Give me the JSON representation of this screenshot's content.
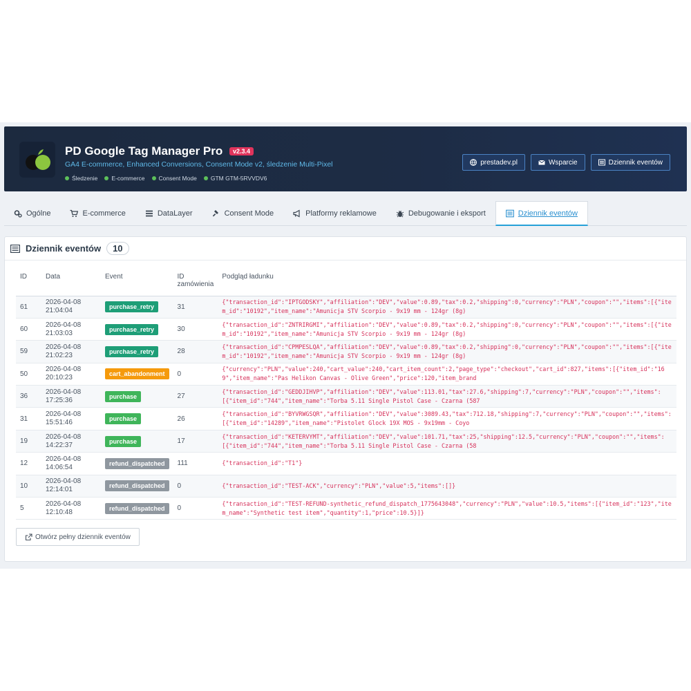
{
  "header": {
    "title": "PD Google Tag Manager Pro",
    "version": "v2.3.4",
    "subtitle": "GA4 E-commerce, Enhanced Conversions, Consent Mode v2, śledzenie Multi-Pixel",
    "features": [
      "Śledzenie",
      "E-commerce",
      "Consent Mode",
      "GTM GTM-5RVVDV6"
    ],
    "buttons": [
      {
        "label": "prestadev.pl",
        "icon": "globe-icon"
      },
      {
        "label": "Wsparcie",
        "icon": "envelope-icon"
      },
      {
        "label": "Dziennik eventów",
        "icon": "list-icon"
      }
    ]
  },
  "tabs": [
    {
      "label": "Ogólne",
      "icon": "cogs-icon"
    },
    {
      "label": "E-commerce",
      "icon": "cart-icon"
    },
    {
      "label": "DataLayer",
      "icon": "list-icon"
    },
    {
      "label": "Consent Mode",
      "icon": "gavel-icon"
    },
    {
      "label": "Platformy reklamowe",
      "icon": "bullhorn-icon"
    },
    {
      "label": "Debugowanie i eksport",
      "icon": "bug-icon"
    },
    {
      "label": "Dziennik eventów",
      "icon": "list-icon",
      "active": true
    }
  ],
  "panel": {
    "title": "Dziennik eventów",
    "count": "10",
    "columns": [
      "ID",
      "Data",
      "Event",
      "ID zamówienia",
      "Podgląd ładunku"
    ],
    "open_button": "Otwórz pełny dziennik eventów"
  },
  "colors": {
    "purchase_retry": "#1e9e77",
    "purchase": "#3fb55a",
    "cart_abandonment": "#f59a0c",
    "refund_dispatched": "#8f979f",
    "payload": "#d6305a",
    "accent": "#25a0d8"
  },
  "rows": [
    {
      "id": "61",
      "date": "2026-04-08",
      "time": "21:04:04",
      "event": "purchase_retry",
      "order": "31",
      "payload": "{\"transaction_id\":\"IPTGODSKY\",\"affiliation\":\"DEV\",\"value\":0.89,\"tax\":0.2,\"shipping\":0,\"currency\":\"PLN\",\"coupon\":\"\",\"items\":[{\"item_id\":\"10192\",\"item_name\":\"Amunicja STV Scorpio - 9x19 mm - 124gr (8g)"
    },
    {
      "id": "60",
      "date": "2026-04-08",
      "time": "21:03:03",
      "event": "purchase_retry",
      "order": "30",
      "payload": "{\"transaction_id\":\"ZNTRIRGMI\",\"affiliation\":\"DEV\",\"value\":0.89,\"tax\":0.2,\"shipping\":0,\"currency\":\"PLN\",\"coupon\":\"\",\"items\":[{\"item_id\":\"10192\",\"item_name\":\"Amunicja STV Scorpio - 9x19 mm - 124gr (8g)"
    },
    {
      "id": "59",
      "date": "2026-04-08",
      "time": "21:02:23",
      "event": "purchase_retry",
      "order": "28",
      "payload": "{\"transaction_id\":\"CPMPESLQA\",\"affiliation\":\"DEV\",\"value\":0.89,\"tax\":0.2,\"shipping\":0,\"currency\":\"PLN\",\"coupon\":\"\",\"items\":[{\"item_id\":\"10192\",\"item_name\":\"Amunicja STV Scorpio - 9x19 mm - 124gr (8g)"
    },
    {
      "id": "50",
      "date": "2026-04-08",
      "time": "20:10:23",
      "event": "cart_abandonment",
      "order": "0",
      "payload": "{\"currency\":\"PLN\",\"value\":240,\"cart_value\":240,\"cart_item_count\":2,\"page_type\":\"checkout\",\"cart_id\":827,\"items\":[{\"item_id\":\"169\",\"item_name\":\"Pas Helikon Canvas - Olive Green\",\"price\":120,\"item_brand"
    },
    {
      "id": "36",
      "date": "2026-04-08",
      "time": "17:25:36",
      "event": "purchase",
      "order": "27",
      "payload": "{\"transaction_id\":\"GEDDJIHVP\",\"affiliation\":\"DEV\",\"value\":113.01,\"tax\":27.6,\"shipping\":7,\"currency\":\"PLN\",\"coupon\":\"\",\"items\":[{\"item_id\":\"744\",\"item_name\":\"Torba 5.11 Single Pistol Case - Czarna (587"
    },
    {
      "id": "31",
      "date": "2026-04-08",
      "time": "15:51:46",
      "event": "purchase",
      "order": "26",
      "payload": "{\"transaction_id\":\"BYVRWGSQR\",\"affiliation\":\"DEV\",\"value\":3089.43,\"tax\":712.18,\"shipping\":7,\"currency\":\"PLN\",\"coupon\":\"\",\"items\":[{\"item_id\":\"14289\",\"item_name\":\"Pistolet Glock 19X MOS - 9x19mm - Coyo"
    },
    {
      "id": "19",
      "date": "2026-04-08",
      "time": "14:22:37",
      "event": "purchase",
      "order": "17",
      "payload": "{\"transaction_id\":\"KETERVYMT\",\"affiliation\":\"DEV\",\"value\":101.71,\"tax\":25,\"shipping\":12.5,\"currency\":\"PLN\",\"coupon\":\"\",\"items\":[{\"item_id\":\"744\",\"item_name\":\"Torba 5.11 Single Pistol Case - Czarna (58"
    },
    {
      "id": "12",
      "date": "2026-04-08",
      "time": "14:06:54",
      "event": "refund_dispatched",
      "order": "111",
      "payload": "{\"transaction_id\":\"T1\"}"
    },
    {
      "id": "10",
      "date": "2026-04-08",
      "time": "12:14:01",
      "event": "refund_dispatched",
      "order": "0",
      "payload": "{\"transaction_id\":\"TEST-ACK\",\"currency\":\"PLN\",\"value\":5,\"items\":[]}"
    },
    {
      "id": "5",
      "date": "2026-04-08",
      "time": "12:10:48",
      "event": "refund_dispatched",
      "order": "0",
      "payload": "{\"transaction_id\":\"TEST-REFUND-synthetic_refund_dispatch_1775643048\",\"currency\":\"PLN\",\"value\":10.5,\"items\":[{\"item_id\":\"123\",\"item_name\":\"Synthetic test item\",\"quantity\":1,\"price\":10.5}]}"
    }
  ]
}
